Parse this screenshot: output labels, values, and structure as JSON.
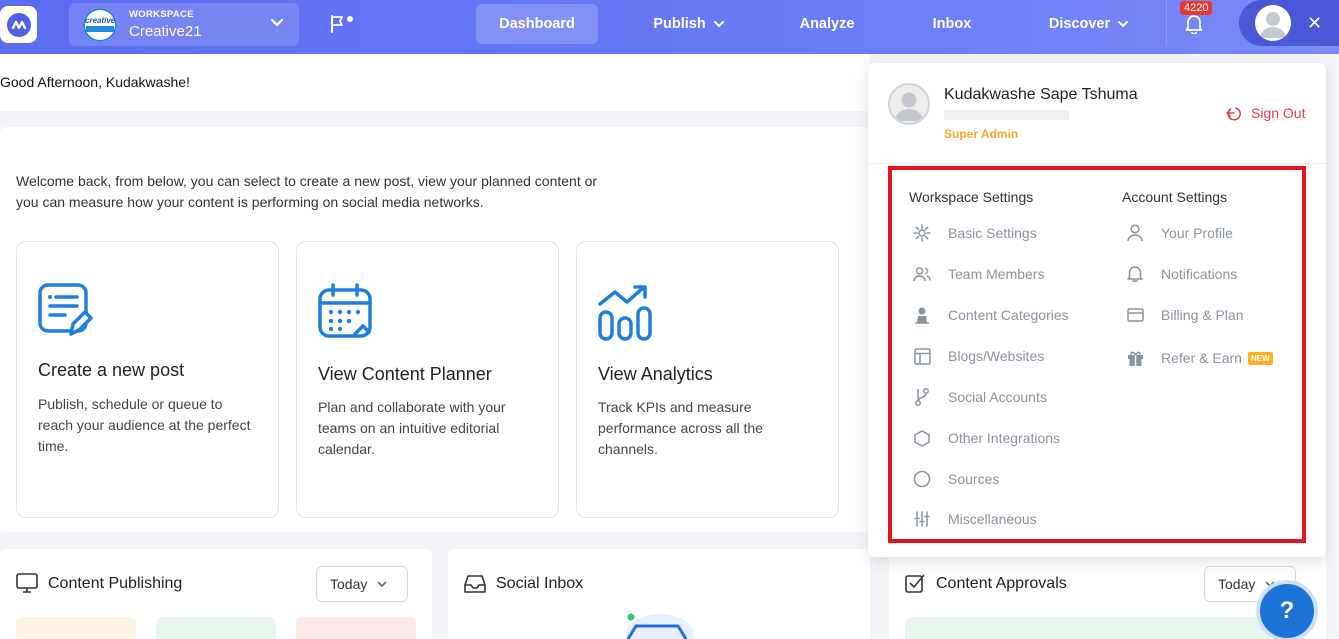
{
  "header": {
    "workspace_label": "WORKSPACE",
    "workspace_name": "Creative21",
    "workspace_logo_text": "creative",
    "nav": [
      "Dashboard",
      "Publish",
      "Analyze",
      "Inbox",
      "Discover"
    ],
    "active_nav": "Dashboard",
    "notification_count": "4220",
    "brand_color": "#5b6cf1"
  },
  "greeting": "Good Afternoon, Kudakwashe!",
  "welcome": {
    "intro": "Welcome back, from below, you can select to create a new post, view your planned content or you can measure how your content is performing on social media networks.",
    "cards": [
      {
        "title": "Create a new post",
        "desc": "Publish, schedule or queue to reach your audience at the perfect time.",
        "icon": "compose-icon"
      },
      {
        "title": "View Content Planner",
        "desc": "Plan and collaborate with your teams on an intuitive editorial calendar.",
        "icon": "calendar-icon"
      },
      {
        "title": "View Analytics",
        "desc": "Track KPIs and measure performance across all the channels.",
        "icon": "analytics-icon"
      }
    ]
  },
  "widgets": {
    "publishing": {
      "title": "Content Publishing",
      "filter": "Today"
    },
    "inbox": {
      "title": "Social Inbox"
    },
    "approvals": {
      "title": "Content Approvals",
      "filter": "Today"
    }
  },
  "profile": {
    "name": "Kudakwashe Sape Tshuma",
    "role": "Super Admin",
    "sign_out": "Sign Out"
  },
  "workspace_settings": {
    "heading": "Workspace Settings",
    "items": [
      "Basic Settings",
      "Team Members",
      "Content Categories",
      "Blogs/Websites",
      "Social Accounts",
      "Other Integrations",
      "Sources",
      "Miscellaneous"
    ]
  },
  "account_settings": {
    "heading": "Account Settings",
    "items": [
      "Your Profile",
      "Notifications",
      "Billing & Plan",
      "Refer & Earn"
    ],
    "new_badge": "NEW"
  },
  "help_label": "?",
  "colors": {
    "highlight": "#e8141c",
    "role": "#f5a623",
    "sign_out": "#e8394d"
  }
}
